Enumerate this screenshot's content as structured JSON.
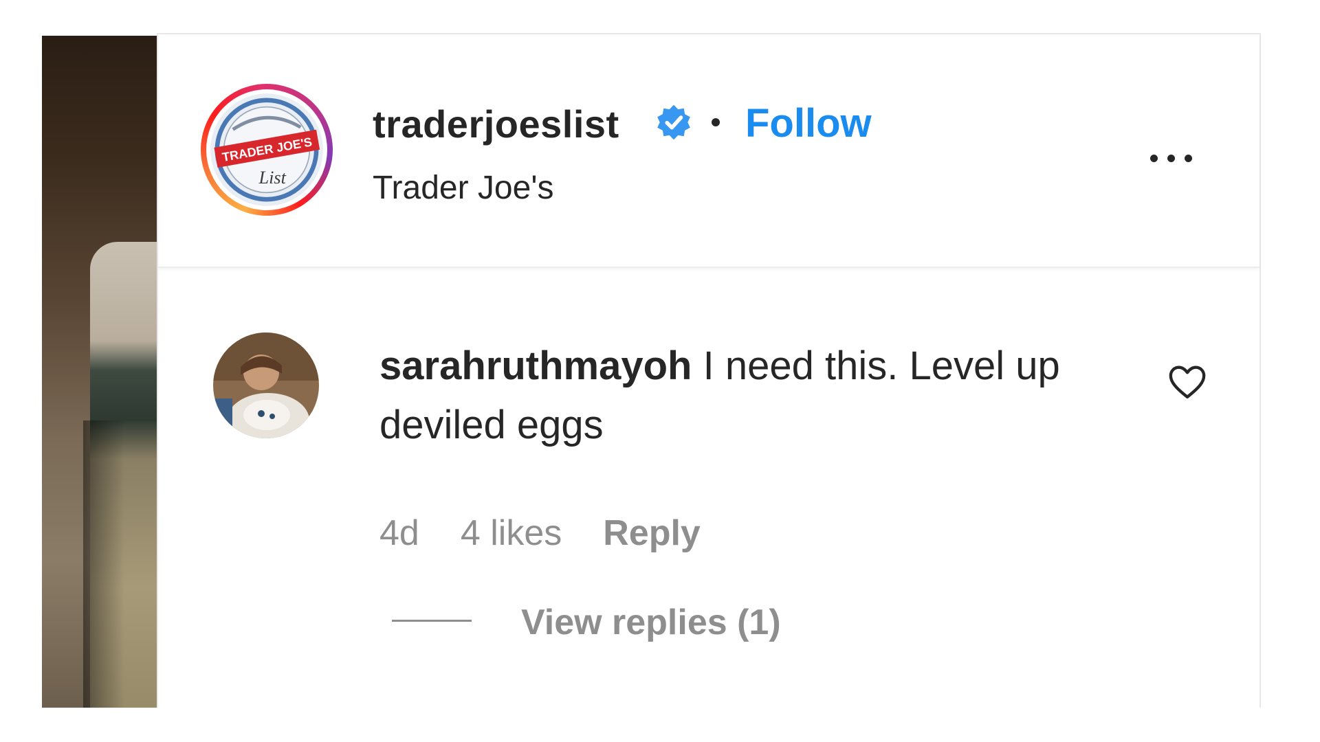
{
  "post": {
    "author": {
      "username": "traderjoeslist",
      "verified": true,
      "verified_icon": "verified-badge-icon",
      "separator": "•",
      "follow_label": "Follow",
      "subtitle": "Trader Joe's",
      "avatar_logo_text": [
        "TRADER JOE'S",
        "List"
      ]
    },
    "more_icon": "more-options-icon"
  },
  "comment": {
    "username": "sarahruthmayoh",
    "text": "I need this. Level up deviled eggs",
    "age": "4d",
    "likes": "4 likes",
    "reply_label": "Reply",
    "like_icon": "heart-icon",
    "view_replies_label": "View replies (1)"
  },
  "colors": {
    "follow": "#1a8cf0",
    "verified": "#3897f0",
    "text_primary": "#262626",
    "text_secondary": "#8e8e8e"
  }
}
